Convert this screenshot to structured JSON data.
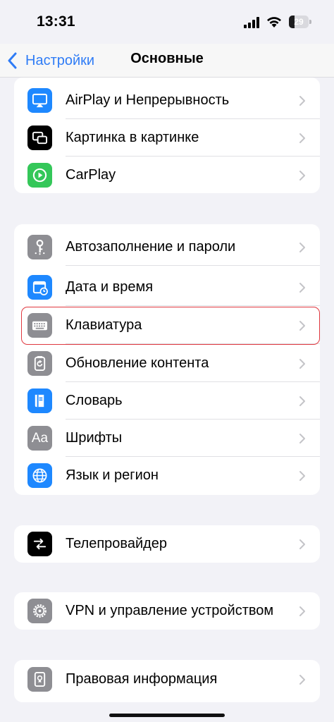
{
  "status_bar": {
    "time": "13:31",
    "battery_level": "29",
    "battery_fraction": 0.29
  },
  "nav": {
    "back_label": "Настройки",
    "title": "Основные"
  },
  "groups": [
    {
      "rows": [
        {
          "label": "AirPlay и Непрерывность",
          "icon": "airplay-icon",
          "color": "#1e88ff"
        },
        {
          "label": "Картинка в картинке",
          "icon": "picture-in-picture-icon",
          "color": "#000000"
        },
        {
          "label": "CarPlay",
          "icon": "carplay-icon",
          "color": "#34c759"
        }
      ]
    },
    {
      "rows": [
        {
          "label": "Автозаполнение и пароли",
          "icon": "key-icon",
          "color": "#8e8e93"
        },
        {
          "label": "Дата и время",
          "icon": "calendar-clock-icon",
          "color": "#1e88ff"
        },
        {
          "label": "Клавиатура",
          "icon": "keyboard-icon",
          "color": "#8e8e93",
          "highlighted": true
        },
        {
          "label": "Обновление контента",
          "icon": "refresh-icon",
          "color": "#8e8e93"
        },
        {
          "label": "Словарь",
          "icon": "book-icon",
          "color": "#1e88ff"
        },
        {
          "label": "Шрифты",
          "icon": "font-icon",
          "color": "#8e8e93",
          "glyph": "Aa"
        },
        {
          "label": "Язык и регион",
          "icon": "globe-icon",
          "color": "#1e88ff"
        }
      ]
    },
    {
      "rows": [
        {
          "label": "Телепровайдер",
          "icon": "tv-provider-icon",
          "color": "#000000"
        }
      ]
    },
    {
      "rows": [
        {
          "label": "VPN и управление устройством",
          "icon": "gear-icon",
          "color": "#8e8e93"
        }
      ]
    },
    {
      "rows": [
        {
          "label": "Правовая информация",
          "icon": "legal-document-icon",
          "color": "#8e8e93"
        }
      ]
    }
  ],
  "colors": {
    "accent": "#2f7cf6",
    "highlight_border": "#e0383f",
    "background": "#f2f2f7"
  }
}
